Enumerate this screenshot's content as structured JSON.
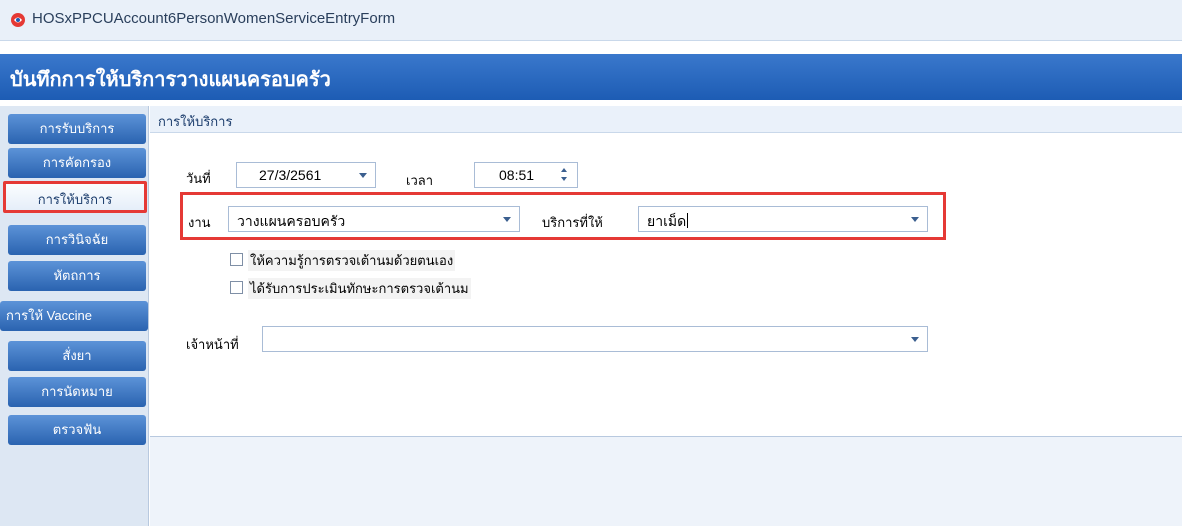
{
  "window": {
    "title": "HOSxPPCUAccount6PersonWomenServiceEntryForm"
  },
  "header": {
    "title": "บันทึกการให้บริการวางแผนครอบครัว"
  },
  "sidebar": {
    "items": [
      {
        "label": "การรับบริการ"
      },
      {
        "label": "การคัดกรอง"
      },
      {
        "label": "การให้บริการ",
        "active": true
      },
      {
        "label": "การวินิจฉัย"
      },
      {
        "label": "หัตถการ"
      },
      {
        "label": "การให้ Vaccine"
      },
      {
        "label": "สั่งยา"
      },
      {
        "label": "การนัดหมาย"
      },
      {
        "label": "ตรวจฟัน"
      }
    ]
  },
  "section": {
    "title": "การให้บริการ"
  },
  "form": {
    "date_label": "วันที่",
    "date_value": "27/3/2561",
    "time_label": "เวลา",
    "time_value": "08:51",
    "task_label": "งาน",
    "task_value": "วางแผนครอบครัว",
    "service_label": "บริการที่ให้",
    "service_value": "ยาเม็ด",
    "checkbox1_label": "ให้ความรู้การตรวจเต้านมด้วยตนเอง",
    "checkbox1_checked": false,
    "checkbox2_label": "ได้รับการประเมินทักษะการตรวจเต้านม",
    "checkbox2_checked": false,
    "staff_label": "เจ้าหน้าที่",
    "staff_value": ""
  },
  "colors": {
    "header_blue": "#2a6bc2",
    "nav_blue": "#3f7bc8",
    "highlight_red": "#e53935"
  }
}
